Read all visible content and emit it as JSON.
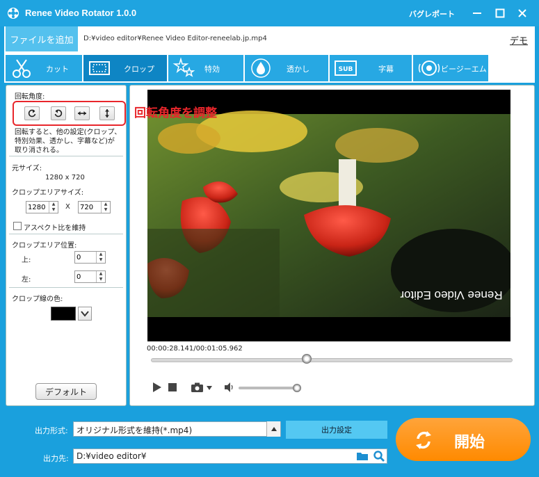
{
  "window": {
    "title": "Renee Video Rotator 1.0.0",
    "bug_report": "バグレポート"
  },
  "file_row": {
    "add_file": "ファイルを追加",
    "file_path": "D:¥video editor¥Renee Video Editor-reneelab.jp.mp4",
    "demo": "デモ"
  },
  "tabs": [
    {
      "label": "カット",
      "icon": "scissors-icon"
    },
    {
      "label": "クロップ",
      "icon": "crop-icon",
      "active": true
    },
    {
      "label": "特効",
      "icon": "stars-icon"
    },
    {
      "label": "透かし",
      "icon": "watermark-drop-icon"
    },
    {
      "label": "字幕",
      "icon": "subtitle-icon"
    },
    {
      "label": "ビージーエム",
      "icon": "music-icon"
    }
  ],
  "left_panel": {
    "rotation_label": "回転角度:",
    "rotation_note_1": "回転すると、他の設定(クロップ、",
    "rotation_note_2": "特別効果、透かし、字幕など)が",
    "rotation_note_3": "取り消される。",
    "original_size_label": "元サイズ:",
    "original_size_value": "1280 x 720",
    "crop_area_size_label": "クロップエリアサイズ:",
    "crop_width": "1280",
    "crop_x": "X",
    "crop_height": "720",
    "keep_aspect": "アスペクト比を維持",
    "crop_position_label": "クロップエリア位置:",
    "top_label": "上:",
    "top_value": "0",
    "left_label": "左:",
    "left_value": "0",
    "crop_line_color_label": "クロップ線の色:",
    "crop_line_color": "#000000",
    "default_button": "デフォルト"
  },
  "annotation": {
    "text": "回転角度を調整",
    "color": "#e8262b"
  },
  "preview": {
    "watermark_text": "Renee Video Editor",
    "time_current": "00:00:28.141",
    "time_separator": "/",
    "time_total": "00:01:05.962",
    "seek_position": 0.43,
    "volume_level": 0.9
  },
  "output": {
    "format_label": "出力形式:",
    "format_value": "オリジナル形式を維持(*.mp4)",
    "settings_button": "出力設定",
    "dest_label": "出力先:",
    "dest_value": "D:¥video editor¥",
    "start_button": "開始"
  },
  "colors": {
    "accent": "#1fa4e0",
    "tab_active": "#0e85c4",
    "start": "#ff8a00"
  }
}
